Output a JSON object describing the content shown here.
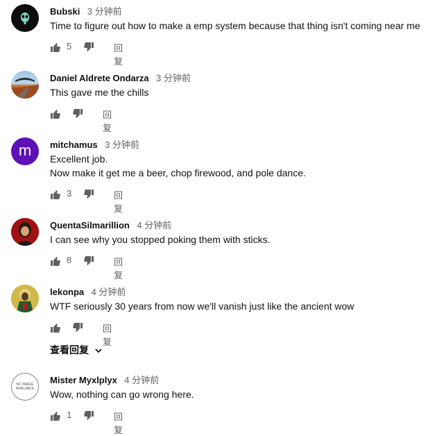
{
  "comments": [
    {
      "author": "Bubski",
      "time": "3 分钟前",
      "lines": [
        "Time to figure out how to make a emp system because that thing isn't coming near me"
      ],
      "likes": "5",
      "reply": "回复",
      "avatar": "alien-avatar"
    },
    {
      "author": "Daniel Aldrete Ondarza",
      "time": "3 分钟前",
      "lines": [
        "This gave me the chills"
      ],
      "likes": "",
      "reply": "回复",
      "avatar": "landscape-avatar"
    },
    {
      "author": "mitchamus",
      "time": "3 分钟前",
      "lines": [
        "Excellent job.",
        "Now make it get me a beer, chop firewood, and pole dance."
      ],
      "likes": "3",
      "reply": "回复",
      "avatar": "letter-avatar",
      "avatar_letter": "m",
      "avatar_color": "#5e0fb5"
    },
    {
      "author": "QuentaSilmarillion",
      "time": "4 分钟前",
      "lines": [
        "I can see why you stopped poking them with sticks."
      ],
      "likes": "8",
      "reply": "回复",
      "avatar": "photo-avatar"
    },
    {
      "author": "lekonpa",
      "time": "4 分钟前",
      "lines": [
        "WTF seriously 30 years from now we'll vanish just like the ancient wow"
      ],
      "likes": "",
      "reply": "回复",
      "avatar": "icon-avatar"
    },
    {
      "author": "Mister Myxlplyx",
      "time": "4 分钟前",
      "lines": [
        "Wow, nothing can go wrong here."
      ],
      "likes": "1",
      "reply": "回复",
      "avatar": "no-image-avatar",
      "avatar_text": "NO IMAGE AVAILABLE"
    }
  ],
  "view_replies_label": "查看回复",
  "colors": {
    "text": "#0f0f0f",
    "muted": "#606060",
    "icon": "#606060"
  }
}
